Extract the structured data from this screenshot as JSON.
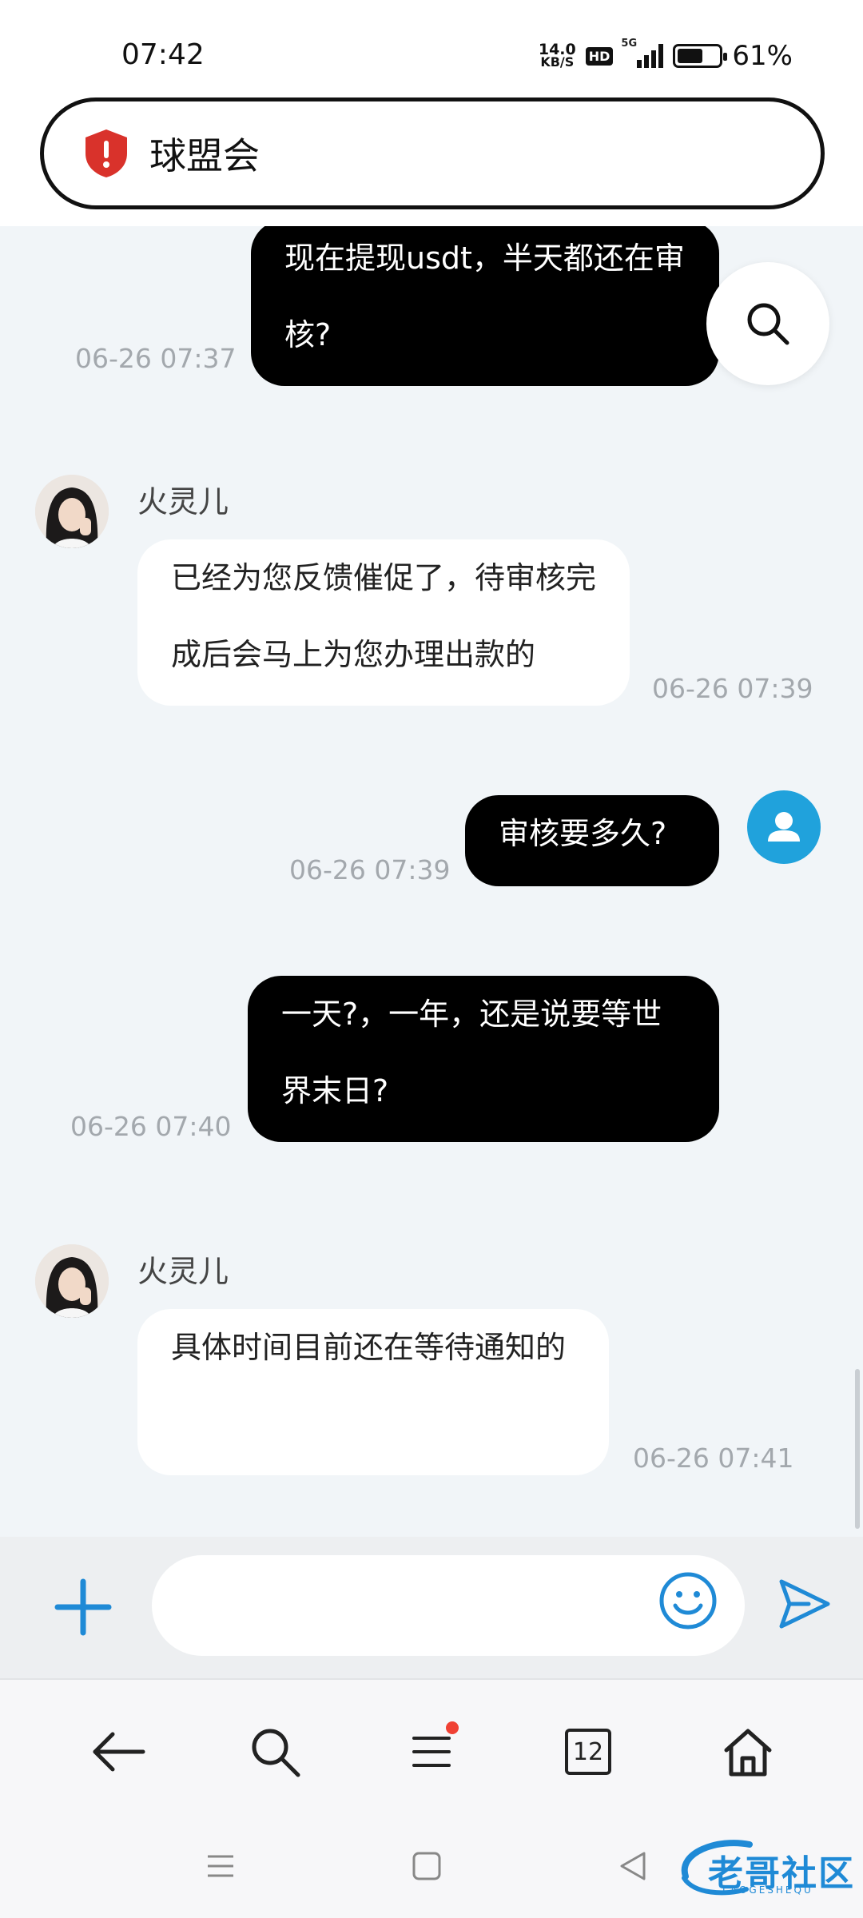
{
  "status_bar": {
    "time": "07:42",
    "net_speed_value": "14.0",
    "net_speed_unit": "KB/S",
    "hd_label": "HD",
    "network_label": "5G",
    "battery_percent": "61%",
    "battery_level": 0.61
  },
  "address_bar": {
    "site_name": "球盟会",
    "security_icon": "shield-alert-icon"
  },
  "messages": [
    {
      "from": "me",
      "text": "现在提现usdt，半天都还在审核?",
      "time": "06-26 07:37"
    },
    {
      "from": "agent",
      "sender": "火灵儿",
      "text": "已经为您反馈催促了，待审核完成后会马上为您办理出款的",
      "time": "06-26 07:39"
    },
    {
      "from": "me",
      "text": "审核要多久?",
      "time": "06-26 07:39"
    },
    {
      "from": "me",
      "text": "一天?，一年，还是说要等世界末日?",
      "time": "06-26 07:40"
    },
    {
      "from": "agent",
      "sender": "火灵儿",
      "text": "具体时间目前还在等待通知的",
      "time": "06-26 07:41"
    }
  ],
  "composer": {
    "value": "",
    "placeholder": ""
  },
  "browser_nav": {
    "tab_count": "12"
  },
  "watermark": {
    "text": "老哥社区",
    "subtext": "LAOGESHEQU"
  },
  "colors": {
    "accent": "#20a2dc",
    "chat_bg": "#f1f5f8",
    "my_bubble": "#000000",
    "their_bubble": "#ffffff",
    "notification_dot": "#f04134"
  }
}
